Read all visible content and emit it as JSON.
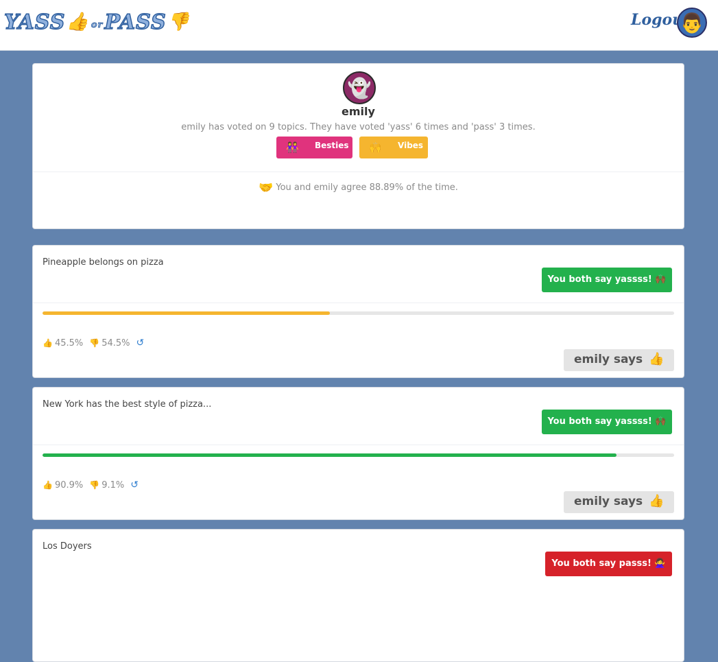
{
  "nav": {
    "logo_left": "YASS",
    "logo_or": "or",
    "logo_right": "PASS",
    "logo_thumb_up": "👍",
    "logo_thumb_down": "👎",
    "logout_label": "Logout",
    "avatar_emoji": "👨"
  },
  "profile": {
    "avatar_emoji": "👻",
    "name": "emily",
    "stats_text": "emily has voted on 9 topics. They have voted 'yass' 6 times and 'pass' 3 times.",
    "badges": [
      {
        "emoji": "👭",
        "label": "Besties",
        "color": "#e0337d"
      },
      {
        "emoji": "🙌",
        "label": "Vibes",
        "color": "#f5b52f"
      }
    ],
    "agreement_text": "You and emily agree 88.89% of the time.",
    "agreement_icon": "handshake-icon"
  },
  "topics": [
    {
      "title": "Pineapple belongs on pizza",
      "verdict": "You both say yassss! 🙌🏾",
      "verdict_type": "yass",
      "yass_percent_label": "45.5%",
      "pass_percent_label": "54.5%",
      "yass_fraction": 0.455,
      "bar_color": "#f5b52f",
      "says_label": "emily says",
      "says_icon": "thumbs-up-icon"
    },
    {
      "title": "New York has the best style of pizza...",
      "verdict": "You both say yassss! 🙌🏾",
      "verdict_type": "yass",
      "yass_percent_label": "90.9%",
      "pass_percent_label": "9.1%",
      "yass_fraction": 0.909,
      "bar_color": "#23b14d",
      "says_label": "emily says",
      "says_icon": "thumbs-up-icon"
    },
    {
      "title": "Los Doyers",
      "verdict": "You both say passs! 🙅‍♀️",
      "verdict_type": "pass"
    }
  ],
  "colors": {
    "background": "#6283ae",
    "yass": "#23b14d",
    "pass": "#d6222a",
    "accent_purple": "#a347cf"
  }
}
